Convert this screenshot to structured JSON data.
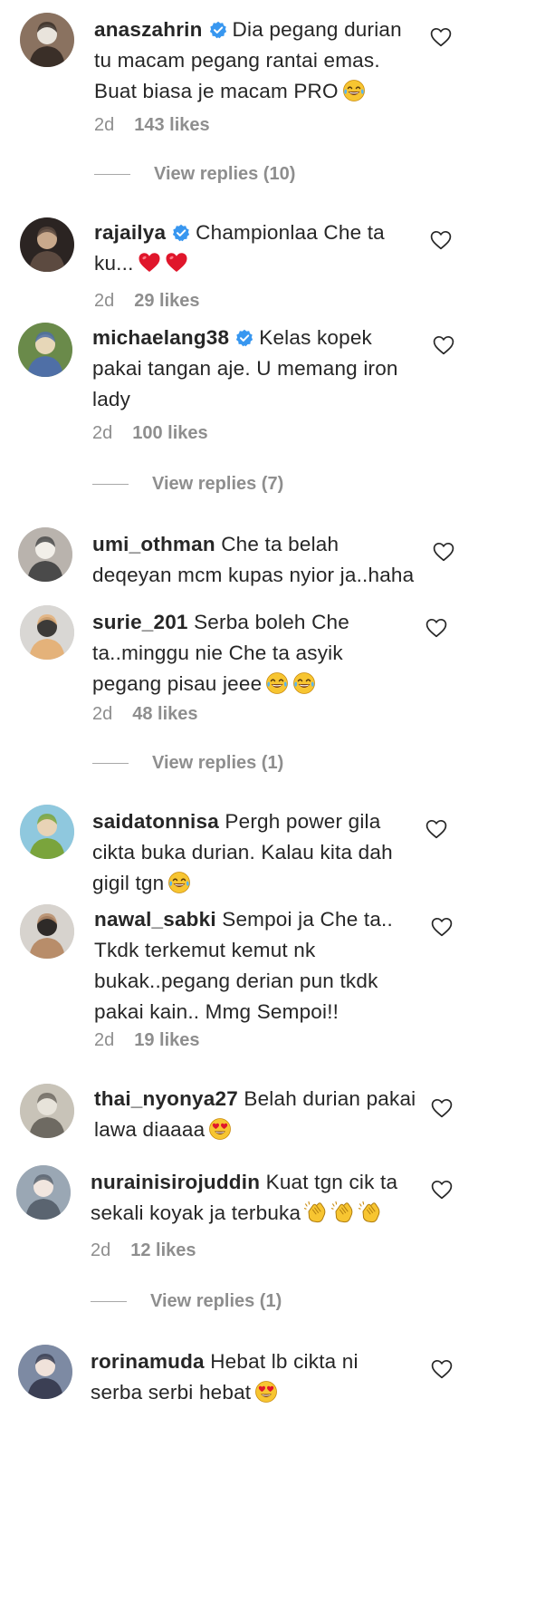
{
  "comments": [
    {
      "username": "anaszahrin",
      "verified": true,
      "lines": [
        "Dia pegang durian",
        "tu macam pegang rantai emas.",
        "Buat biasa je macam PRO"
      ],
      "emojis": [
        "face-with-tears-of-joy"
      ],
      "time": "2d",
      "likes": "143 likes",
      "replies": "View replies (10)",
      "avatar_colors": [
        "#8a7260",
        "#e9e4dc",
        "#3a2f28"
      ]
    },
    {
      "username": "rajailya",
      "verified": true,
      "lines": [
        "Championlaa Che ta",
        "ku..."
      ],
      "emojis": [
        "red-heart",
        "red-heart"
      ],
      "time": "2d",
      "likes": "29 likes",
      "replies": "",
      "avatar_colors": [
        "#2b2422",
        "#c9a98c",
        "#5c4a40"
      ]
    },
    {
      "username": "michaelang38",
      "verified": true,
      "lines": [
        "Kelas kopek",
        "pakai tangan aje. U memang iron",
        "lady"
      ],
      "emojis": [],
      "time": "2d",
      "likes": "100 likes",
      "replies": "View replies (7)",
      "avatar_colors": [
        "#6a8a4a",
        "#e7d7b8",
        "#4f6fa6"
      ]
    },
    {
      "username": "umi_othman",
      "verified": false,
      "lines": [
        "Che ta belah",
        "deqeyan mcm kupas nyior ja..haha"
      ],
      "emojis": [],
      "time": "",
      "likes": "",
      "replies": "",
      "avatar_colors": [
        "#b9b3ad",
        "#f2efe9",
        "#4a4a4a"
      ]
    },
    {
      "username": "surie_201",
      "verified": false,
      "lines": [
        "Serba boleh Che",
        "ta..minggu nie Che ta asyik",
        "pegang pisau jeee"
      ],
      "emojis": [
        "face-with-tears-of-joy",
        "face-with-tears-of-joy"
      ],
      "time": "2d",
      "likes": "48 likes",
      "replies": "View replies (1)",
      "avatar_colors": [
        "#d9d7d4",
        "#3c3a38",
        "#e4b27a"
      ]
    },
    {
      "username": "saidatonnisa",
      "verified": false,
      "lines": [
        "Pergh power gila",
        "cikta buka durian. Kalau kita dah",
        "gigil tgn"
      ],
      "emojis": [
        "face-with-tears-of-joy"
      ],
      "time": "",
      "likes": "",
      "replies": "",
      "avatar_colors": [
        "#8fc8de",
        "#e8d3b6",
        "#7aa43c"
      ]
    },
    {
      "username": "nawal_sabki",
      "verified": false,
      "lines": [
        "Sempoi ja Che ta..",
        "Tkdk terkemut kemut nk",
        "bukak..pegang derian pun tkdk",
        "pakai kain.. Mmg Sempoi!!"
      ],
      "emojis": [],
      "time": "2d",
      "likes": "19 likes",
      "replies": "",
      "avatar_colors": [
        "#d7d3ce",
        "#2e2a28",
        "#b88d6a"
      ]
    },
    {
      "username": "thai_nyonya27",
      "verified": false,
      "lines": [
        "Belah durian pakai",
        "lawa diaaaa"
      ],
      "emojis": [
        "smiling-face-with-heart-eyes"
      ],
      "time": "",
      "likes": "",
      "replies": "",
      "avatar_colors": [
        "#c8c3b8",
        "#e7e3da",
        "#6e6a62"
      ]
    },
    {
      "username": "nurainisirojuddin",
      "verified": false,
      "lines": [
        "Kuat tgn cik ta",
        "sekali koyak ja terbuka"
      ],
      "emojis": [
        "clapping-hands",
        "clapping-hands",
        "clapping-hands"
      ],
      "time": "2d",
      "likes": "12 likes",
      "replies": "View replies (1)",
      "avatar_colors": [
        "#9aa7b4",
        "#f1e6df",
        "#5a6470"
      ]
    },
    {
      "username": "rorinamuda",
      "verified": false,
      "lines": [
        "Hebat lb cikta ni",
        "serba serbi hebat"
      ],
      "emojis": [
        "smiling-face-with-heart-eyes"
      ],
      "time": "",
      "likes": "",
      "replies": "",
      "avatar_colors": [
        "#7d8aa3",
        "#f0e2da",
        "#3b3f54"
      ]
    }
  ]
}
